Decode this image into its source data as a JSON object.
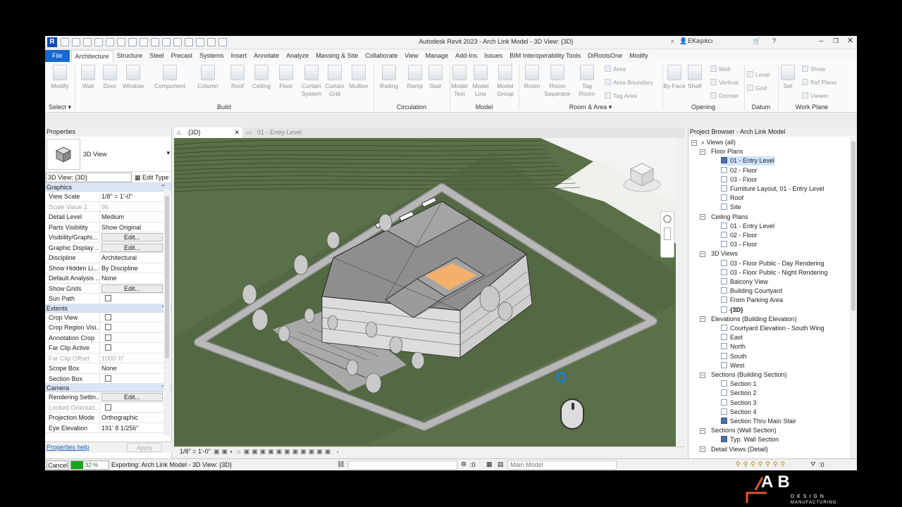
{
  "app": {
    "title": "Autodesk Revit 2023 - Arch Link Model - 3D View: {3D}",
    "user": "EKaşıkcı",
    "logo": "R"
  },
  "tabs": [
    "File",
    "Architecture",
    "Structure",
    "Steel",
    "Precast",
    "Systems",
    "Insert",
    "Annotate",
    "Analyze",
    "Massing & Site",
    "Collaborate",
    "View",
    "Manage",
    "Add-Ins",
    "Issues",
    "BIM Interoperability Tools",
    "DiRootsOne",
    "Modify"
  ],
  "ribbon": {
    "buttons": [
      "Modify",
      "Wall",
      "Door",
      "Window",
      "Component",
      "Column",
      "Roof",
      "Ceiling",
      "Floor",
      "Curtain System",
      "Curtain Grid",
      "Mullion",
      "Railing",
      "Ramp",
      "Stair",
      "Model Text",
      "Model Line",
      "Model Group",
      "Room",
      "Room Separator",
      "Tag Room",
      "By Face",
      "Shaft",
      "Set"
    ],
    "small": [
      "Area",
      "Area Boundary",
      "Tag Area",
      "Wall",
      "Vertical",
      "Dormer",
      "Level",
      "Grid",
      "Show",
      "Ref Plane",
      "Viewer"
    ],
    "groups": [
      "Select",
      "Build",
      "Circulation",
      "Model",
      "Room & Area",
      "Opening",
      "Datum",
      "Work Plane"
    ]
  },
  "properties": {
    "title": "Properties",
    "type_name": "3D View",
    "view_selector": "3D View: {3D}",
    "edit_type": "Edit Type",
    "sections": {
      "graphics": "Graphics",
      "extents": "Extents",
      "camera": "Camera"
    },
    "graphics": [
      {
        "k": "View Scale",
        "v": "1/8\" = 1'-0\""
      },
      {
        "k": "Scale Value    1:",
        "v": "96"
      },
      {
        "k": "Detail Level",
        "v": "Medium"
      },
      {
        "k": "Parts Visibility",
        "v": "Show Original"
      },
      {
        "k": "Visibility/Graphi...",
        "v": "Edit..."
      },
      {
        "k": "Graphic Display ...",
        "v": "Edit..."
      },
      {
        "k": "Discipline",
        "v": "Architectural"
      },
      {
        "k": "Show Hidden Li...",
        "v": "By Discipline"
      },
      {
        "k": "Default Analysis ...",
        "v": "None"
      },
      {
        "k": "Show Grids",
        "v": "Edit..."
      },
      {
        "k": "Sun Path",
        "v": ""
      }
    ],
    "extents": [
      {
        "k": "Crop View",
        "v": ""
      },
      {
        "k": "Crop Region Visi...",
        "v": ""
      },
      {
        "k": "Annotation Crop",
        "v": ""
      },
      {
        "k": "Far Clip Active",
        "v": ""
      },
      {
        "k": "Far Clip Offset",
        "v": "1000'  0\""
      },
      {
        "k": "Scope Box",
        "v": "None"
      },
      {
        "k": "Section Box",
        "v": ""
      }
    ],
    "camera": [
      {
        "k": "Rendering Settin...",
        "v": "Edit..."
      },
      {
        "k": "Locked Orientati...",
        "v": ""
      },
      {
        "k": "Projection Mode",
        "v": "Orthographic"
      },
      {
        "k": "Eye Elevation",
        "v": "191'  8 1/256\""
      }
    ],
    "help": "Properties help",
    "apply": "Apply"
  },
  "view_tabs": [
    "{3D}",
    "01 - Entry Level"
  ],
  "view_scale": "1/8\" = 1'-0\"",
  "browser": {
    "title": "Project Browser - Arch Link Model",
    "items": [
      "Views (all)",
      "Floor Plans",
      "01 - Entry Level",
      "02 - Floor",
      "03 - Floor",
      "Furniture Layout,  01 - Entry Level",
      "Roof",
      "Site",
      "Ceiling Plans",
      "01 - Entry Level",
      "02 - Floor",
      "03 - Floor",
      "3D Views",
      "03 - Floor Public - Day Rendering",
      "03 - Floor Public - Night Rendering",
      "Balcony View",
      "Building Courtyard",
      "From Parking Area",
      "{3D}",
      "Elevations (Building Elevation)",
      "Courtyard Elevation - South Wing",
      "East",
      "North",
      "South",
      "West",
      "Sections (Building Section)",
      "Section 1",
      "Section 2",
      "Section 3",
      "Section 4",
      "Section Thru Main Stair",
      "Sections (Wall Section)",
      "Typ. Wall Section",
      "Detail Views (Detail)"
    ]
  },
  "status": {
    "cancel": "Cancel",
    "progress_pct": 32,
    "progress_label": "32 %",
    "text": "Exporting: Arch Link Model - 3D View: {3D}",
    "zero": ":0",
    "model": "Main Model",
    "filter_count": ":0"
  },
  "brand": {
    "letters": "AB",
    "sub1": "DESIGN",
    "sub2": "MANUFACTURING"
  },
  "colors": {
    "accent": "#1769d1",
    "terrain": "#5a7048",
    "roof": "#8e8e8e",
    "courtyard": "#f2b06b"
  }
}
